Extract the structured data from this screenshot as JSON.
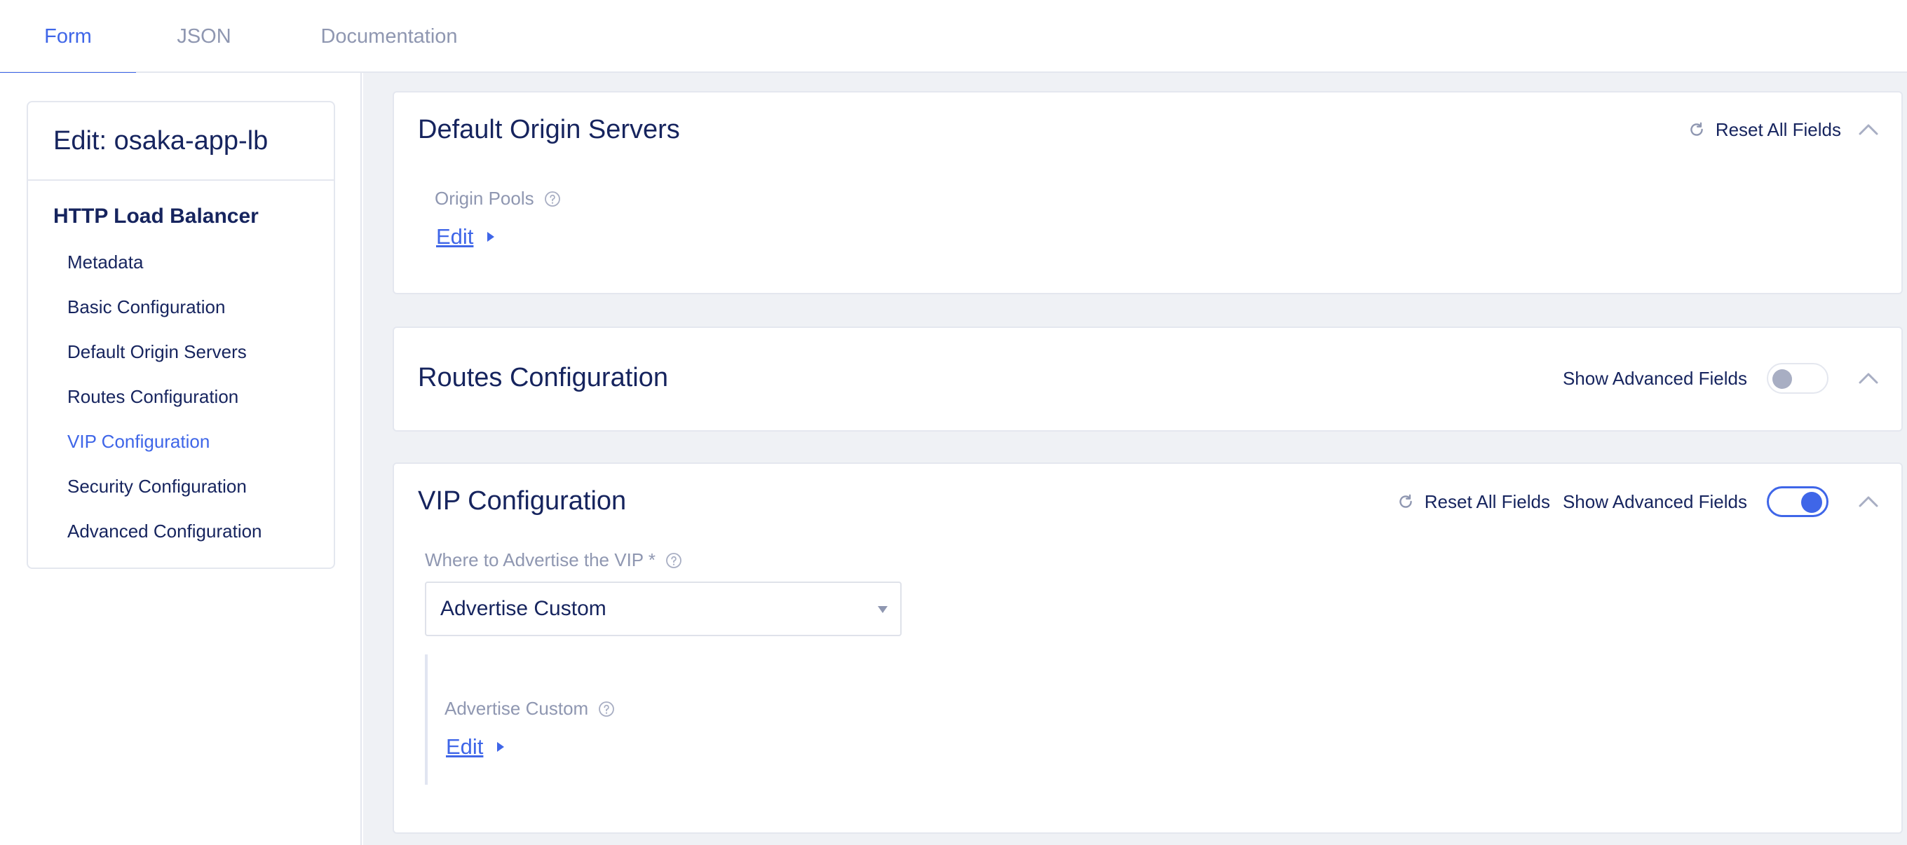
{
  "tabs": {
    "form": "Form",
    "json": "JSON",
    "documentation": "Documentation"
  },
  "sidebar": {
    "title": "Edit: osaka-app-lb",
    "group": "HTTP Load Balancer",
    "items": [
      {
        "label": "Metadata"
      },
      {
        "label": "Basic Configuration"
      },
      {
        "label": "Default Origin Servers"
      },
      {
        "label": "Routes Configuration"
      },
      {
        "label": "VIP Configuration",
        "active": true
      },
      {
        "label": "Security Configuration"
      },
      {
        "label": "Advanced Configuration"
      }
    ]
  },
  "sections": {
    "origin": {
      "title": "Default Origin Servers",
      "reset_label": "Reset All Fields",
      "field_label": "Origin Pools",
      "edit_label": "Edit"
    },
    "routes": {
      "title": "Routes Configuration",
      "show_advanced_label": "Show Advanced Fields",
      "show_advanced_on": false
    },
    "vip": {
      "title": "VIP Configuration",
      "reset_label": "Reset All Fields",
      "show_advanced_label": "Show Advanced Fields",
      "show_advanced_on": true,
      "advertise_label": "Where to Advertise the VIP *",
      "advertise_value": "Advertise Custom",
      "custom_label": "Advertise Custom",
      "edit_label": "Edit"
    }
  },
  "colors": {
    "accent": "#3f66e8",
    "text": "#16245e",
    "muted": "#8f97b1",
    "background": "#eff1f5"
  },
  "icons": [
    "reset-icon",
    "chevron-up-icon",
    "help-icon",
    "caret-right-icon",
    "caret-down-icon"
  ]
}
